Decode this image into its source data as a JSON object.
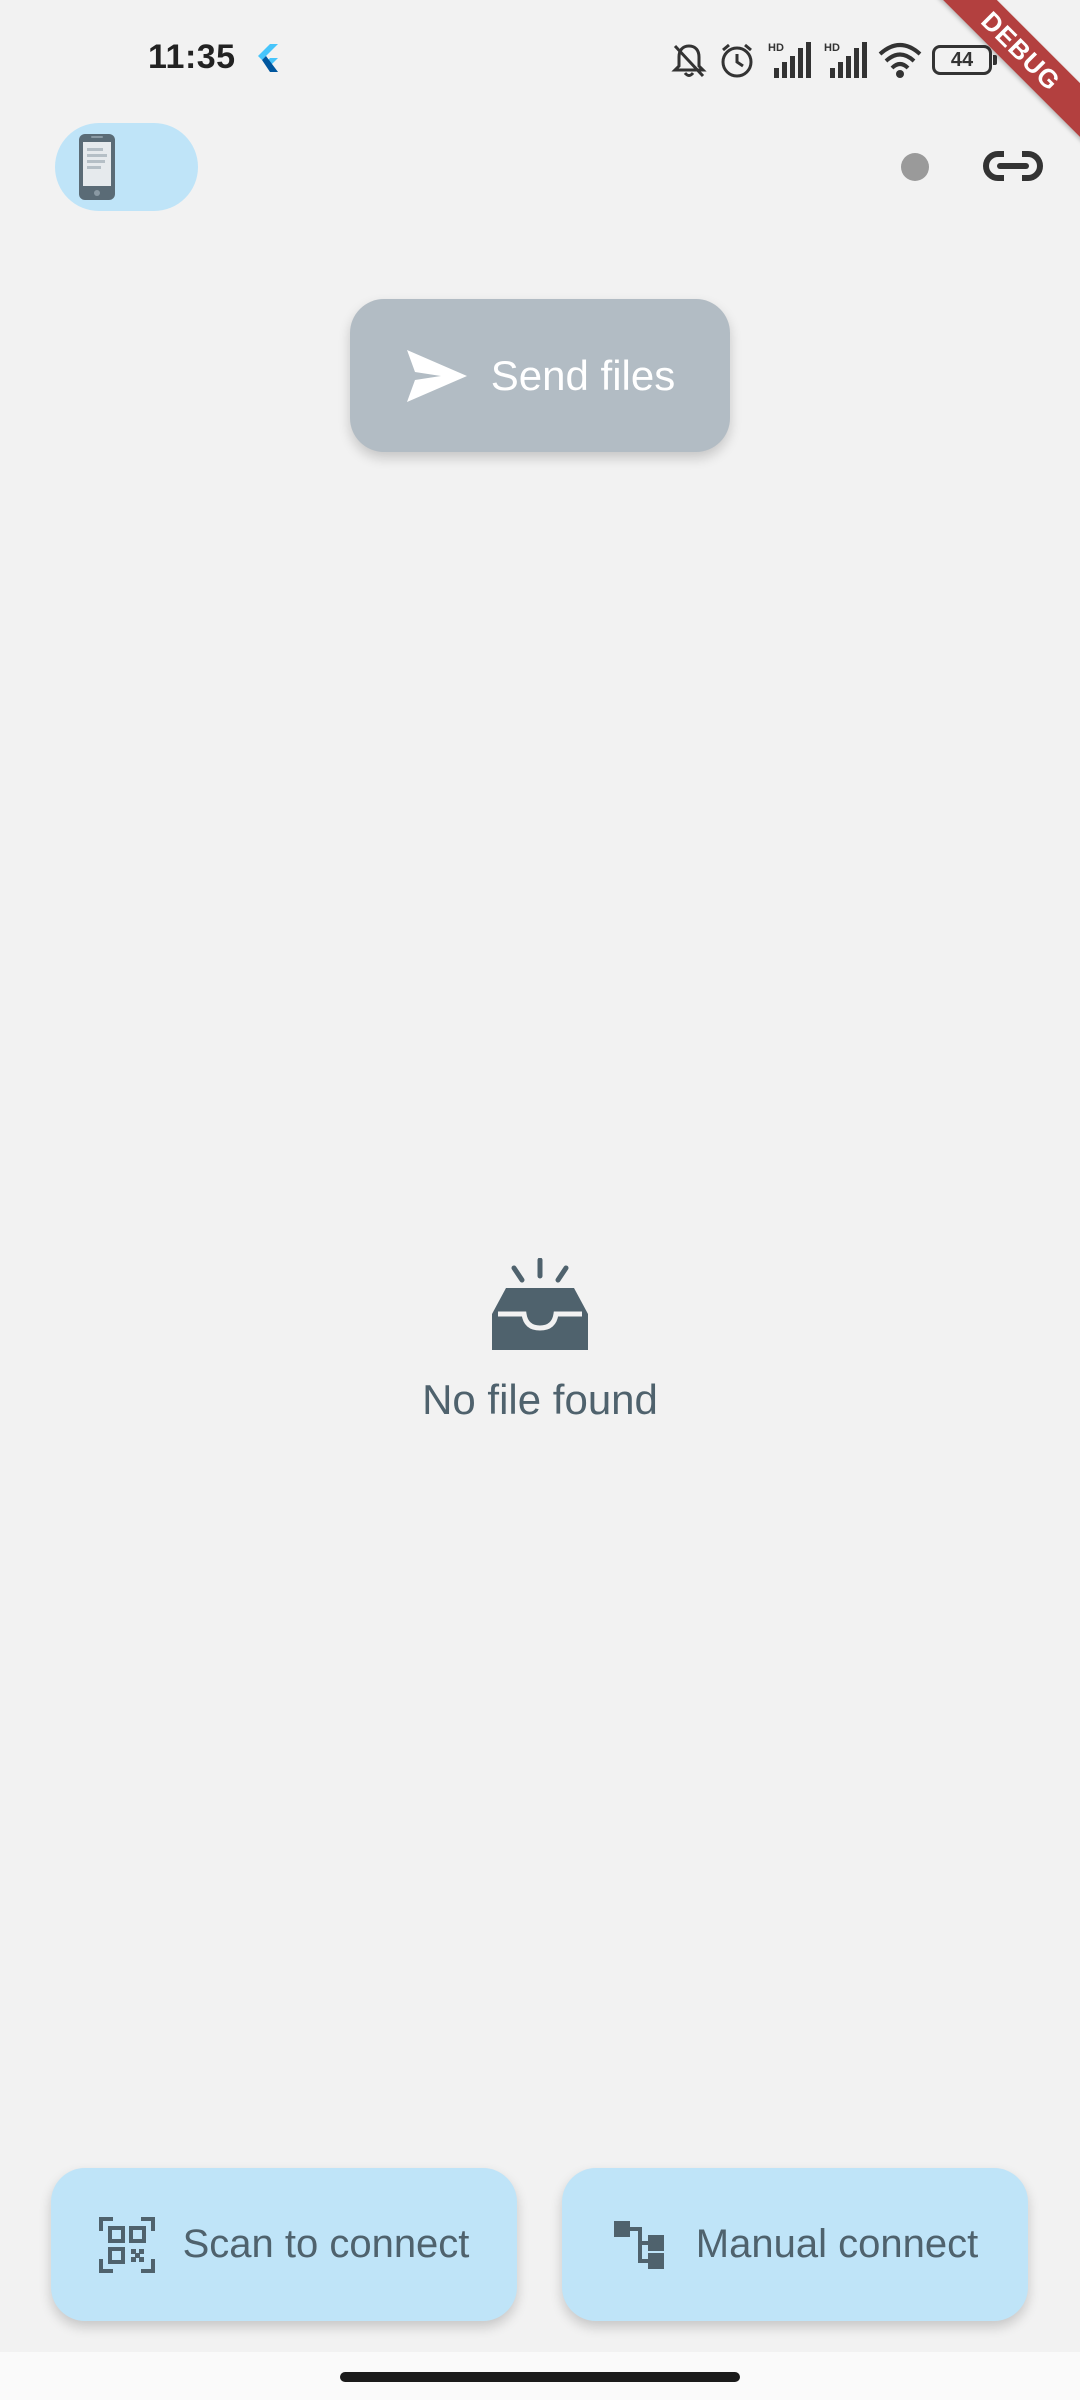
{
  "status_bar": {
    "time": "11:35",
    "battery_level": "44",
    "icons": [
      "flutter-icon",
      "bell-off-icon",
      "alarm-icon",
      "signal-hd-icon",
      "signal-hd-icon",
      "wifi-icon",
      "battery-icon"
    ],
    "hd_label": "HD"
  },
  "debug_banner": {
    "label": "DEBUG",
    "color": "#b3403f"
  },
  "header": {
    "device_icon": "phone-icon",
    "connection_dot_color": "#9a9a9a",
    "link_icon": "link-icon"
  },
  "send_button": {
    "label": "Send files",
    "icon": "send-icon",
    "background": "#b2bcc4"
  },
  "empty_state": {
    "icon": "inbox-icon",
    "message": "No file found"
  },
  "bottom_actions": {
    "scan": {
      "label": "Scan to connect",
      "icon": "qr-scan-icon"
    },
    "manual": {
      "label": "Manual connect",
      "icon": "hierarchy-icon"
    },
    "background": "#bfe4f8"
  },
  "colors": {
    "background": "#f2f2f2",
    "text_primary": "#4f626d",
    "accent": "#bfe4f8"
  }
}
